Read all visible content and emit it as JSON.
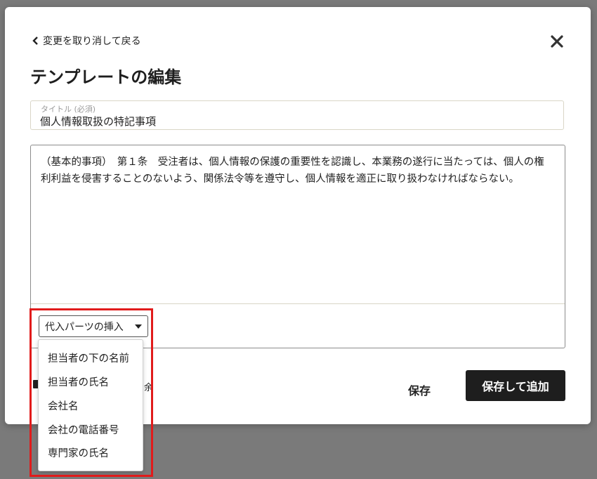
{
  "modal": {
    "back_label": "変更を取り消して戻る",
    "heading": "テンプレートの編集",
    "title_field": {
      "label": "タイトル (必須)",
      "value": "個人情報取扱の特記事項"
    },
    "body_text": "（基本的事項）　第１条　受注者は、個人情報の保護の重要性を認識し、本業務の遂行に当たっては、個人の権利利益を侵害することのないよう、関係法令等を遵守し、個人情報を適正に取り扱わなければならない。",
    "insert_select_label": "代入パーツの挿入",
    "insert_options": [
      "担当者の下の名前",
      "担当者の氏名",
      "会社名",
      "会社の電話番号",
      "専門家の氏名"
    ],
    "partial_text": "余",
    "save_label": "保存",
    "save_add_label": "保存して追加"
  },
  "colors": {
    "overlay": "#7a7a7a",
    "primary_button": "#1e1e1e",
    "highlight": "#e11b1b"
  },
  "icons": {
    "back": "chevron-left-icon",
    "close": "close-icon"
  }
}
